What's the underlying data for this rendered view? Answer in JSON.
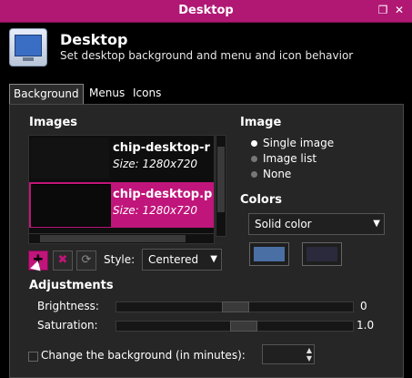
{
  "window": {
    "title": "Desktop",
    "controls": {
      "restore_icon": "restore-icon",
      "close_icon": "close-icon"
    }
  },
  "header": {
    "title": "Desktop",
    "subtitle": "Set desktop background and menu and icon behavior",
    "icon": "desktop-settings-icon"
  },
  "tabs": [
    {
      "label": "Background",
      "active": true
    },
    {
      "label": "Menus",
      "active": false
    },
    {
      "label": "Icons",
      "active": false
    }
  ],
  "images": {
    "label": "Images",
    "items": [
      {
        "name": "chip-desktop-r",
        "size": "Size: 1280x720",
        "selected": false
      },
      {
        "name": "chip-desktop.p",
        "size": "Size: 1280x720",
        "selected": true
      }
    ]
  },
  "buttons": {
    "add_icon": "add-icon",
    "remove_icon": "remove-icon",
    "refresh_icon": "refresh-icon"
  },
  "style": {
    "label": "Style:",
    "value": "Centered"
  },
  "image_mode": {
    "label": "Image",
    "options": [
      {
        "label": "Single image",
        "selected": true
      },
      {
        "label": "Image list",
        "selected": false
      },
      {
        "label": "None",
        "selected": false
      }
    ]
  },
  "colors": {
    "label": "Colors",
    "value": "Solid color",
    "primary": "#4a6fa5",
    "secondary": "#2a2a3c"
  },
  "adjustments": {
    "label": "Adjustments",
    "brightness": {
      "label": "Brightness:",
      "value": "0"
    },
    "saturation": {
      "label": "Saturation:",
      "value": "1.0"
    }
  },
  "change_background": {
    "label": "Change the background (in minutes):",
    "checked": false
  },
  "theme": {
    "accent": "#c0157a",
    "titlebar": "#b01874"
  }
}
